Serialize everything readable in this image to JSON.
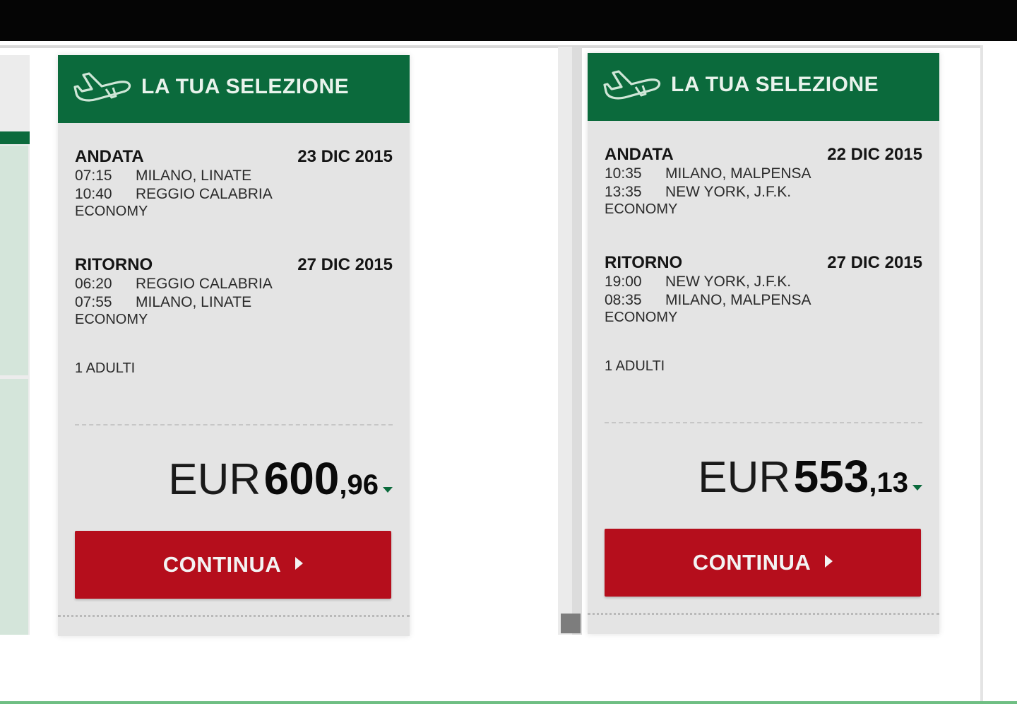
{
  "colors": {
    "header_green": "#0b6a3c",
    "button_red": "#b50e1c",
    "card_gray": "#e4e4e4"
  },
  "cards": [
    {
      "title": "LA TUA SELEZIONE",
      "icon": "plane-icon",
      "andata": {
        "label": "ANDATA",
        "date": "23 DIC 2015",
        "departure_time": "07:15",
        "departure_city": "MILANO, LINATE",
        "arrival_time": "10:40",
        "arrival_city": "REGGIO CALABRIA",
        "cabin": "ECONOMY"
      },
      "ritorno": {
        "label": "RITORNO",
        "date": "27 DIC 2015",
        "departure_time": "06:20",
        "departure_city": "REGGIO CALABRIA",
        "arrival_time": "07:55",
        "arrival_city": "MILANO, LINATE",
        "cabin": "ECONOMY"
      },
      "passengers": "1 ADULTI",
      "price": {
        "currency": "EUR",
        "integer": "600",
        "decimal": ",96"
      },
      "button": "CONTINUA"
    },
    {
      "title": "LA TUA SELEZIONE",
      "icon": "plane-icon",
      "andata": {
        "label": "ANDATA",
        "date": "22 DIC 2015",
        "departure_time": "10:35",
        "departure_city": "MILANO, MALPENSA",
        "arrival_time": "13:35",
        "arrival_city": "NEW YORK, J.F.K.",
        "cabin": "ECONOMY"
      },
      "ritorno": {
        "label": "RITORNO",
        "date": "27 DIC 2015",
        "departure_time": "19:00",
        "departure_city": "NEW YORK, J.F.K.",
        "arrival_time": "08:35",
        "arrival_city": "MILANO, MALPENSA",
        "cabin": "ECONOMY"
      },
      "passengers": "1 ADULTI",
      "price": {
        "currency": "EUR",
        "integer": "553",
        "decimal": ",13"
      },
      "button": "CONTINUA"
    }
  ]
}
